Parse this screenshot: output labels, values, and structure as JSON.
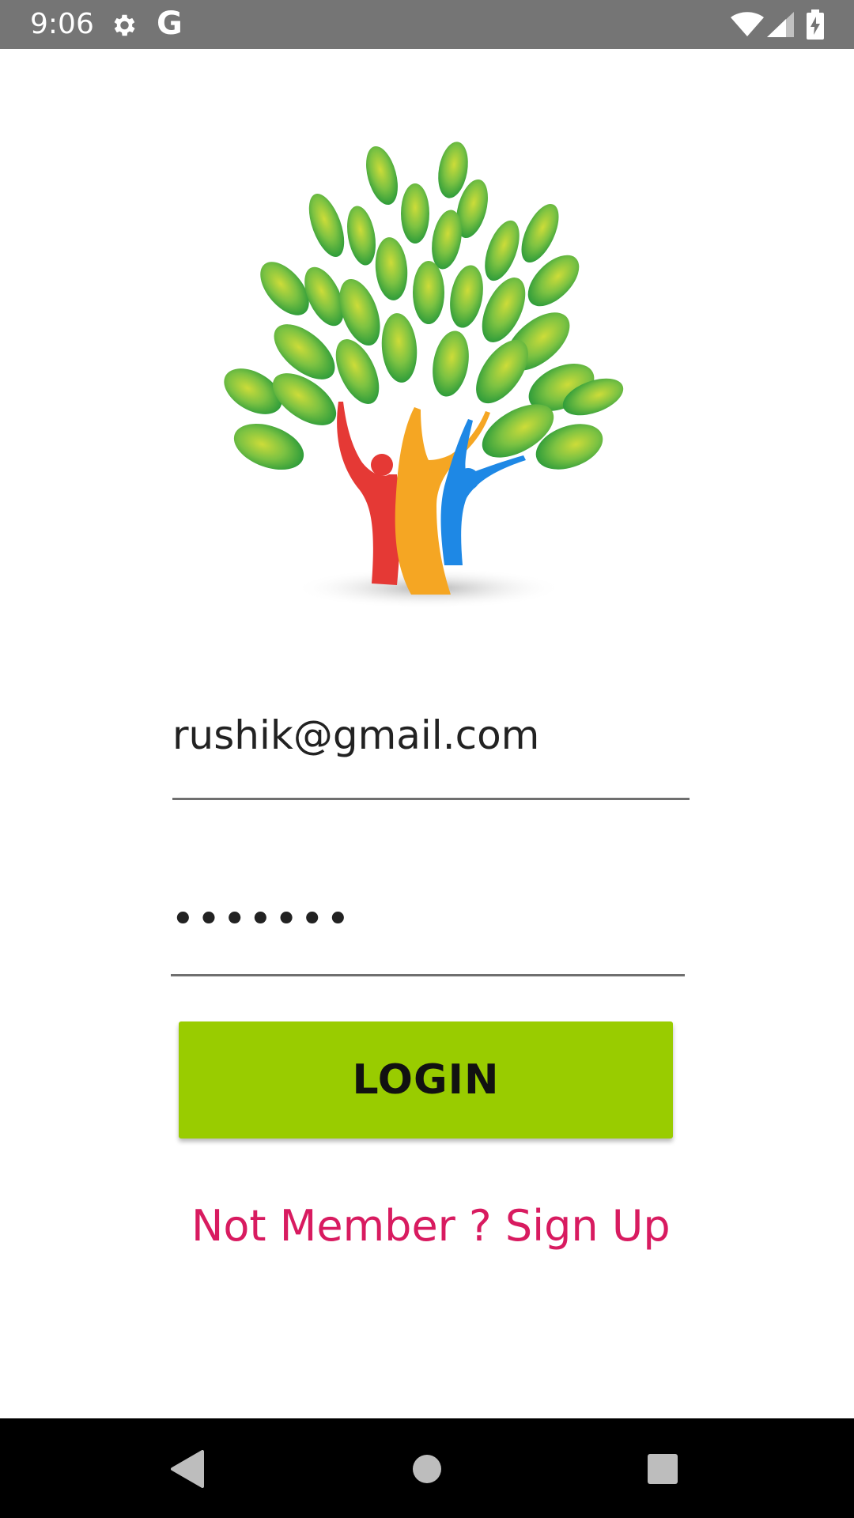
{
  "status_bar": {
    "time": "9:06",
    "g_label": "G",
    "icons": [
      "settings-gear-icon",
      "google-g-icon",
      "wifi-icon",
      "cell-signal-icon",
      "battery-charging-icon"
    ]
  },
  "logo": {
    "icon": "tree-of-people-logo",
    "leaf_color": "#43a047",
    "people_colors": [
      "#e53935",
      "#f5a623",
      "#1e88e5"
    ]
  },
  "login_form": {
    "email_value": "rushik@gmail.com",
    "password_value": "•••••••",
    "login_label": "LOGIN",
    "signup_text": "Not Member ? Sign Up"
  },
  "colors": {
    "button": "#99cc00",
    "link": "#d81b60",
    "status_bar": "#757575",
    "nav_bar": "#000000"
  },
  "nav_bar": {
    "icons": [
      "back-icon",
      "home-icon",
      "recents-icon"
    ]
  }
}
